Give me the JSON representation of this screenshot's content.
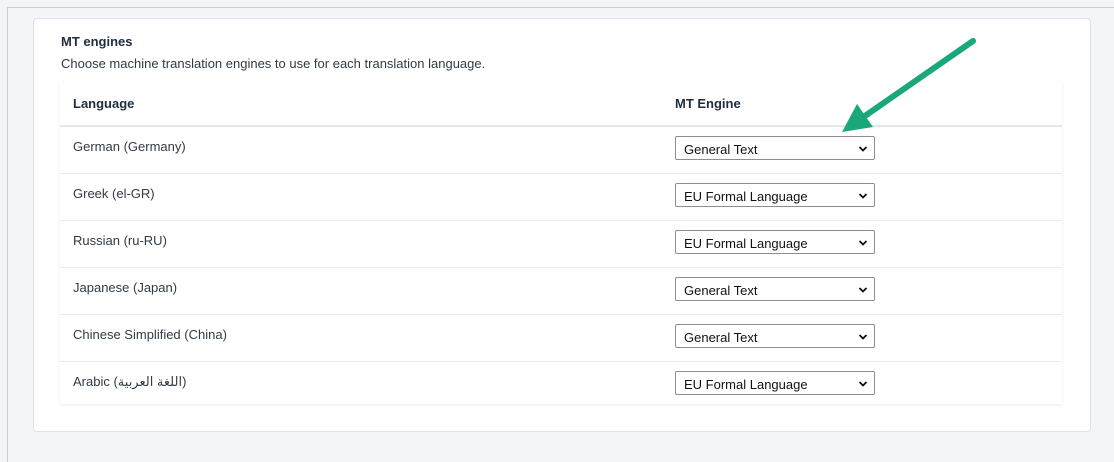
{
  "section": {
    "title": "MT engines",
    "description": "Choose machine translation engines to use for each translation language."
  },
  "table": {
    "headers": {
      "language": "Language",
      "engine": "MT Engine"
    },
    "rows": [
      {
        "language": "German (Germany)",
        "engine": "General Text"
      },
      {
        "language": "Greek (el-GR)",
        "engine": "EU Formal Language"
      },
      {
        "language": "Russian (ru-RU)",
        "engine": "EU Formal Language"
      },
      {
        "language": "Japanese (Japan)",
        "engine": "General Text"
      },
      {
        "language": "Chinese Simplified (China)",
        "engine": "General Text"
      },
      {
        "language": "Arabic (اللغة العربية)",
        "engine": "EU Formal Language"
      }
    ]
  },
  "icons": {
    "chevron": "chevron-down-icon",
    "annotation": "green-arrow-icon"
  },
  "colors": {
    "arrow": "#1aa77c"
  }
}
